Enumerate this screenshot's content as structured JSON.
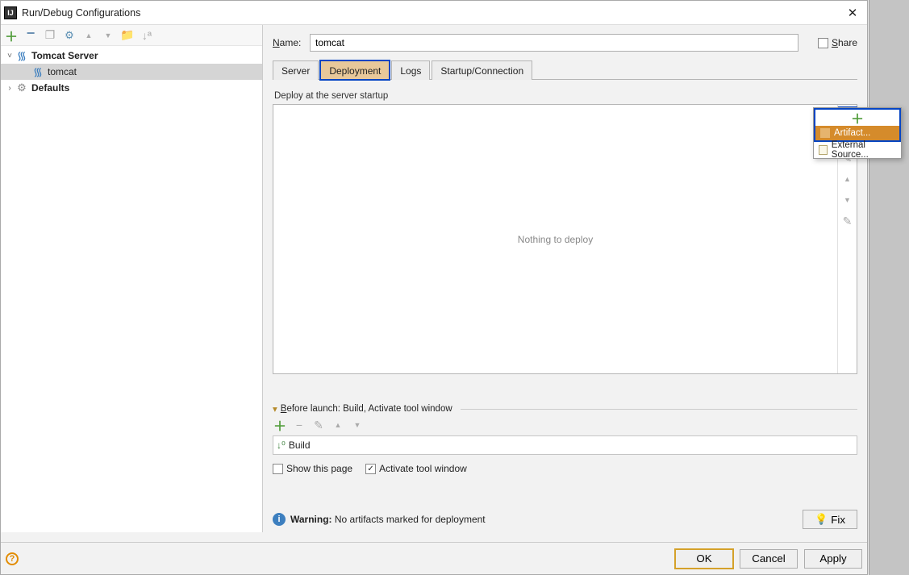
{
  "title": "Run/Debug Configurations",
  "left": {
    "tree": {
      "tomcat_server": "Tomcat Server",
      "tomcat_item": "tomcat",
      "defaults": "Defaults"
    }
  },
  "name": {
    "label": "Name:",
    "value": "tomcat"
  },
  "share": {
    "label": "Share"
  },
  "tabs": {
    "server": "Server",
    "deployment": "Deployment",
    "logs": "Logs",
    "startup": "Startup/Connection"
  },
  "deploy": {
    "header": "Deploy at the server startup",
    "empty": "Nothing to deploy"
  },
  "before_launch": {
    "header": "Before launch: Build, Activate tool window",
    "build": "Build"
  },
  "checks": {
    "show_page": "Show this page",
    "activate_tool": "Activate tool window"
  },
  "warning": {
    "label": "Warning:",
    "text": " No artifacts marked for deployment",
    "fix": "Fix"
  },
  "buttons": {
    "ok": "OK",
    "cancel": "Cancel",
    "apply": "Apply"
  },
  "popup": {
    "artifact": "Artifact...",
    "external": "External Source..."
  }
}
